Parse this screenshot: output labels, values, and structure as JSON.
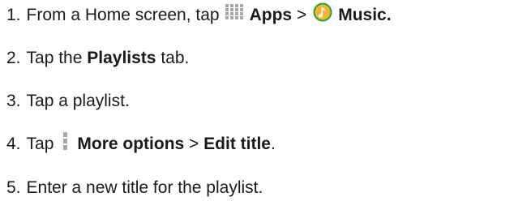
{
  "steps": [
    {
      "number": "1.",
      "text_before": "From a Home screen, tap",
      "apps_icon": "apps-grid-icon",
      "apps_label": "Apps",
      "separator": ">",
      "music_icon": "music-note-icon",
      "music_label": "Music."
    },
    {
      "number": "2.",
      "text_before": "Tap the",
      "bold": "Playlists",
      "text_after": "tab."
    },
    {
      "number": "3.",
      "text": "Tap a playlist."
    },
    {
      "number": "4.",
      "text_before": "Tap",
      "more_icon": "more-options-icon",
      "more_label": "More options",
      "separator": ">",
      "edit_label": "Edit title",
      "end": "."
    },
    {
      "number": "5.",
      "text": "Enter a new title for the playlist."
    }
  ],
  "colors": {
    "text": "#1a1a1a",
    "icon_gray": "#a8a8a8",
    "music_green": "#2e9b3a",
    "music_orange": "#f2b632"
  }
}
